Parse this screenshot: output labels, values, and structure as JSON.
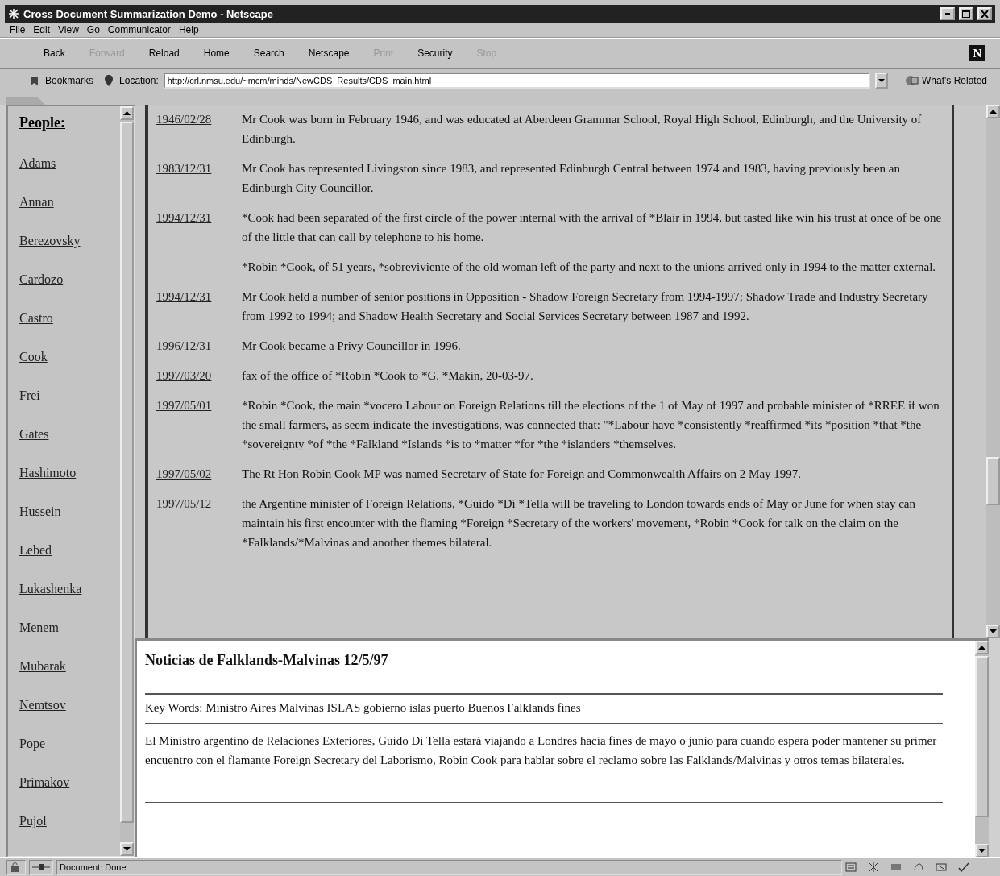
{
  "window": {
    "title": "Cross Document Summarization Demo - Netscape"
  },
  "menu": [
    "File",
    "Edit",
    "View",
    "Go",
    "Communicator",
    "Help"
  ],
  "toolbar": {
    "buttons": [
      {
        "label": "Back",
        "disabled": false
      },
      {
        "label": "Forward",
        "disabled": true
      },
      {
        "label": "Reload",
        "disabled": false
      },
      {
        "label": "Home",
        "disabled": false
      },
      {
        "label": "Search",
        "disabled": false
      },
      {
        "label": "Netscape",
        "disabled": false
      },
      {
        "label": "Print",
        "disabled": true
      },
      {
        "label": "Security",
        "disabled": false
      },
      {
        "label": "Stop",
        "disabled": true
      }
    ],
    "logo": "N"
  },
  "location_bar": {
    "bookmarks": "Bookmarks",
    "location_label": "Location:",
    "url": "http://crl.nmsu.edu/~mcm/minds/NewCDS_Results/CDS_main.html",
    "whats_related": "What's Related"
  },
  "sidebar": {
    "heading": "People:",
    "items": [
      "Adams",
      "Annan",
      "Berezovsky",
      "Cardozo",
      "Castro",
      "Cook",
      "Frei",
      "Gates",
      "Hashimoto",
      "Hussein",
      "Lebed",
      "Lukashenka",
      "Menem",
      "Mubarak",
      "Nemtsov",
      "Pope",
      "Primakov",
      "Pujol"
    ]
  },
  "timeline": [
    {
      "date": "1946/02/28",
      "paragraphs": [
        "Mr Cook was born in February 1946, and was educated at Aberdeen Grammar School, Royal High School, Edinburgh, and the University of Edinburgh."
      ]
    },
    {
      "date": "1983/12/31",
      "paragraphs": [
        "Mr Cook has represented Livingston since 1983, and represented Edinburgh Central between 1974 and 1983, having previously been an Edinburgh City Councillor."
      ]
    },
    {
      "date": "1994/12/31",
      "paragraphs": [
        "*Cook had been separated of the first circle of the power internal with the arrival of *Blair in 1994, but tasted like win his trust at once of be one of the little that can call by telephone to his home.",
        "*Robin *Cook, of 51 years, *sobreviviente of the old woman left of the party and next to the unions arrived only in 1994 to the matter external."
      ]
    },
    {
      "date": "1994/12/31",
      "paragraphs": [
        "Mr Cook held a number of senior positions in Opposition - Shadow Foreign Secretary from 1994-1997; Shadow Trade and Industry Secretary from 1992 to 1994; and Shadow Health Secretary and Social Services Secretary between 1987 and 1992."
      ]
    },
    {
      "date": "1996/12/31",
      "paragraphs": [
        "Mr Cook became a Privy Councillor in 1996."
      ]
    },
    {
      "date": "1997/03/20",
      "paragraphs": [
        "fax of the office of *Robin *Cook to *G. *Makin, 20-03-97."
      ]
    },
    {
      "date": "1997/05/01",
      "paragraphs": [
        "*Robin *Cook, the main *vocero Labour on Foreign Relations till the elections of the 1 of May of 1997 and probable minister of *RREE if won the small farmers, as seem indicate the investigations, was connected that: \"*Labour have *consistently *reaffirmed *its *position *that *the *sovereignty *of *the *Falkland *Islands *is to *matter *for *the *islanders *themselves."
      ]
    },
    {
      "date": "1997/05/02",
      "paragraphs": [
        "The Rt Hon Robin Cook MP was named Secretary of State for Foreign and Commonwealth Affairs on 2 May 1997."
      ]
    },
    {
      "date": "1997/05/12",
      "paragraphs": [
        "the Argentine minister of Foreign Relations, *Guido *Di *Tella will be traveling to London towards ends of May or June for when stay can maintain his first encounter with the flaming *Foreign *Secretary of the workers' movement, *Robin *Cook for talk on the claim on the *Falklands/*Malvinas and another themes bilateral."
      ]
    }
  ],
  "article": {
    "title": "Noticias de Falklands-Malvinas 12/5/97",
    "keywords": "Key Words: Ministro Aires Malvinas ISLAS gobierno islas puerto Buenos Falklands fines",
    "body": "El Ministro argentino de Relaciones Exteriores, Guido Di Tella estará viajando a Londres hacia fines de mayo o junio para cuando espera poder mantener su primer encuentro con el flamante Foreign Secretary del Laborismo, Robin Cook para hablar sobre el reclamo sobre las Falklands/Malvinas y otros temas bilaterales."
  },
  "status_bar": {
    "text": "Document: Done"
  }
}
